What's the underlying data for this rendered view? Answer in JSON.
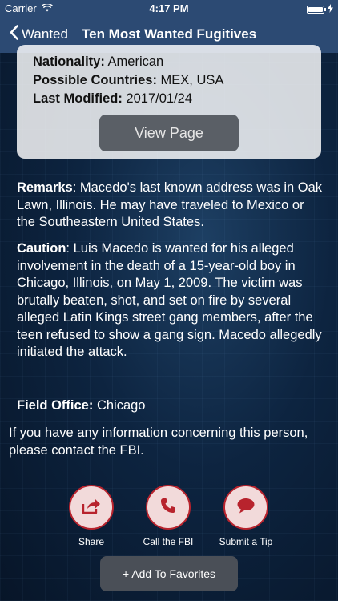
{
  "status_bar": {
    "carrier": "Carrier",
    "time": "4:17 PM"
  },
  "nav": {
    "back_label": "Wanted",
    "title": "Ten Most Wanted Fugitives"
  },
  "details": {
    "nationality_label": "Nationality:",
    "nationality_value": "American",
    "countries_label": "Possible Countries:",
    "countries_value": "MEX, USA",
    "modified_label": "Last Modified:",
    "modified_value": "2017/01/24"
  },
  "view_page_label": "View Page",
  "remarks": {
    "label": "Remarks",
    "text": ": Macedo's last known address was in Oak Lawn, Illinois. He may have traveled to Mexico or the Southeastern United States."
  },
  "caution": {
    "label": "Caution",
    "text": ": Luis Macedo is wanted for his alleged involvement in the death of a 15-year-old boy in Chicago, Illinois, on May 1, 2009. The victim was brutally beaten, shot, and set on fire by several alleged Latin Kings street gang members, after the teen refused to show a gang sign. Macedo allegedly initiated the attack."
  },
  "field_office": {
    "label": "Field Office:",
    "value": "Chicago"
  },
  "contact_text": "If you have any information concerning this person, please contact the FBI.",
  "actions": {
    "share": {
      "label": "Share",
      "icon": "share-icon"
    },
    "call": {
      "label": "Call the FBI",
      "icon": "phone-icon"
    },
    "tip": {
      "label": "Submit a Tip",
      "icon": "speech-bubble-icon"
    }
  },
  "favorites_label": "+ Add To Favorites",
  "colors": {
    "nav_bar": "#2c4a73",
    "accent_red": "#b8232d",
    "circle_fill": "#f2dada"
  }
}
